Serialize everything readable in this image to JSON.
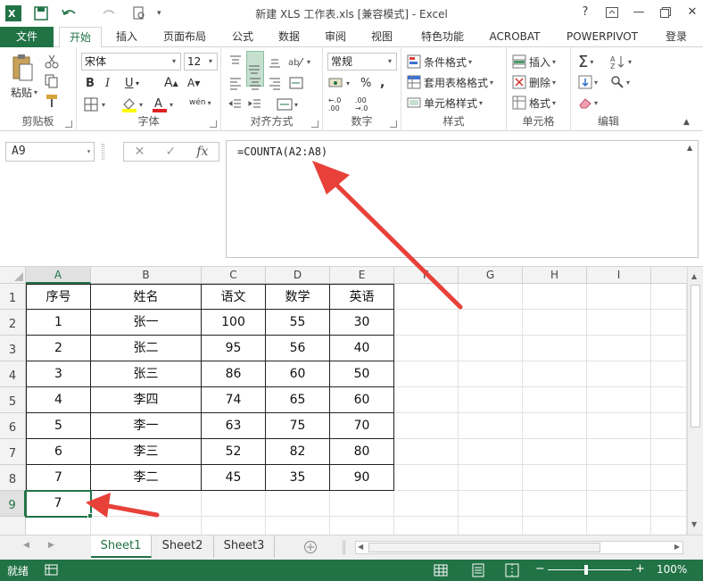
{
  "window": {
    "title": "新建 XLS 工作表.xls  [兼容模式] - Excel",
    "help": "?",
    "minimize": "—",
    "close": "✕"
  },
  "tabs": [
    {
      "label": "文件"
    },
    {
      "label": "开始"
    },
    {
      "label": "插入"
    },
    {
      "label": "页面布局"
    },
    {
      "label": "公式"
    },
    {
      "label": "数据"
    },
    {
      "label": "审阅"
    },
    {
      "label": "视图"
    },
    {
      "label": "特色功能"
    },
    {
      "label": "ACROBAT"
    },
    {
      "label": "POWERPIVOT"
    },
    {
      "label": "登录"
    }
  ],
  "ribbon": {
    "clipboard": {
      "paste": "粘贴",
      "label": "剪贴板"
    },
    "font": {
      "name": "宋体",
      "size": "12",
      "label": "字体",
      "bold": "B",
      "italic": "I",
      "underline": "U",
      "grow": "A",
      "shrink": "A",
      "phonetic": "wén"
    },
    "alignment": {
      "label": "对齐方式"
    },
    "number": {
      "format": "常规",
      "label": "数字",
      "percent": "%",
      "comma": ","
    },
    "styles": {
      "label": "样式",
      "conditional": "条件格式",
      "table": "套用表格格式",
      "cell": "单元格样式"
    },
    "cells": {
      "label": "单元格",
      "insert": "插入",
      "delete": "删除",
      "format": "格式"
    },
    "editing": {
      "label": "编辑"
    }
  },
  "formula_bar": {
    "name_box": "A9",
    "cancel": "✕",
    "enter": "✓",
    "fx": "fx",
    "formula": "=COUNTA(A2:A8)"
  },
  "columns": [
    "A",
    "B",
    "C",
    "D",
    "E",
    "F",
    "G",
    "H",
    "I"
  ],
  "rows": [
    "1",
    "2",
    "3",
    "4",
    "5",
    "6",
    "7",
    "8",
    "9"
  ],
  "table": {
    "header": [
      "序号",
      "姓名",
      "语文",
      "数学",
      "英语"
    ],
    "body": [
      [
        "1",
        "张一",
        "100",
        "55",
        "30"
      ],
      [
        "2",
        "张二",
        "95",
        "56",
        "40"
      ],
      [
        "3",
        "张三",
        "86",
        "60",
        "50"
      ],
      [
        "4",
        "李四",
        "74",
        "65",
        "60"
      ],
      [
        "5",
        "李一",
        "63",
        "75",
        "70"
      ],
      [
        "6",
        "李三",
        "52",
        "82",
        "80"
      ],
      [
        "7",
        "李二",
        "45",
        "35",
        "90"
      ]
    ]
  },
  "result_cell": {
    "address": "A9",
    "value": "7"
  },
  "sheets": [
    {
      "label": "Sheet1"
    },
    {
      "label": "Sheet2"
    },
    {
      "label": "Sheet3"
    }
  ],
  "status": {
    "ready": "就绪",
    "zoom": "100%"
  },
  "colors": {
    "accent": "#217346",
    "arrow": "#e8413a"
  }
}
